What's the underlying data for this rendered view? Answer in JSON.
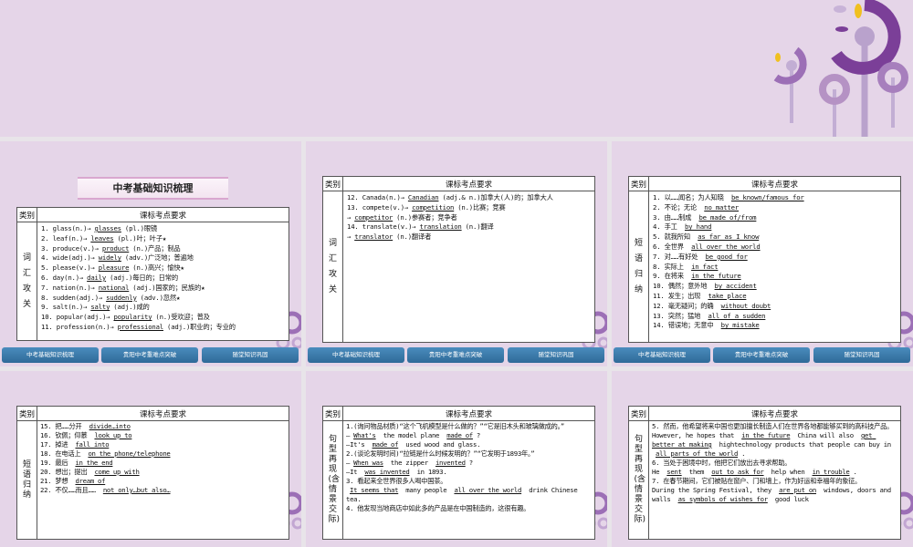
{
  "nav": [
    "中考基础知识梳理",
    "贵阳中考重难点突破",
    "随堂知识巩固"
  ],
  "header": [
    "类别",
    "课标考点要求"
  ],
  "colors": {
    "slide_bg": "#e5d5e8",
    "nav_button": "#3a78a8",
    "flower_dark": "#7b3f98",
    "flower_light": "#b9a2cc",
    "flower_yellow": "#f0c020"
  },
  "slides": [
    {
      "banner": "中考基础知识梳理",
      "category": "词汇攻关",
      "lines": [
        [
          {
            "text": "1. glass(n.)→"
          },
          {
            "text": "glasses",
            "blank": true
          },
          {
            "text": "(pl.)眼镜"
          }
        ],
        [
          {
            "text": "2. leaf(n.)→"
          },
          {
            "text": "leaves",
            "blank": true
          },
          {
            "text": "(pl.)叶；叶子★"
          }
        ],
        [
          {
            "text": "3. produce(v.)→"
          },
          {
            "text": "product",
            "blank": true
          },
          {
            "text": "(n.)产品；制品"
          }
        ],
        [
          {
            "text": "4. wide(adj.)→"
          },
          {
            "text": "widely",
            "blank": true
          },
          {
            "text": "(adv.)广泛地；普遍地"
          }
        ],
        [
          {
            "text": "5. please(v.)→"
          },
          {
            "text": "pleasure",
            "blank": true
          },
          {
            "text": "(n.)高兴；愉快★"
          }
        ],
        [
          {
            "text": "6. day(n.)→"
          },
          {
            "text": "daily",
            "blank": true
          },
          {
            "text": "(adj.)每日的；日常的"
          }
        ],
        [
          {
            "text": "7. nation(n.)→"
          },
          {
            "text": "national",
            "blank": true
          },
          {
            "text": "(adj.)国家的；民族的★"
          }
        ],
        [
          {
            "text": "8. sudden(adj.)→"
          },
          {
            "text": "suddenly",
            "blank": true
          },
          {
            "text": "(adv.)忽然★"
          }
        ],
        [
          {
            "text": "9. salt(n.)→"
          },
          {
            "text": "salty",
            "blank": true
          },
          {
            "text": "(adj.)咸的"
          }
        ],
        [
          {
            "text": "10. popular(adj.)→"
          },
          {
            "text": "popularity",
            "blank": true
          },
          {
            "text": "(n.)受欢迎；普及"
          }
        ],
        [
          {
            "text": "11. profession(n.)→"
          },
          {
            "text": "professional",
            "blank": true
          },
          {
            "text": "(adj.)职业的；专业的"
          }
        ]
      ]
    },
    {
      "category": "词汇攻关",
      "lines": [
        [
          {
            "text": "12. Canada(n.)→"
          },
          {
            "text": "Canadian",
            "blank": true
          },
          {
            "text": "(adj.& n.)加拿大(人)的；加拿大人"
          }
        ],
        [
          {
            "text": "13. compete(v.)→"
          },
          {
            "text": "competition",
            "blank": true
          },
          {
            "text": "(n.)比赛；竞赛"
          }
        ],
        [
          {
            "text": "→"
          },
          {
            "text": "competitor",
            "blank": true
          },
          {
            "text": "(n.)参赛者；竞争者"
          }
        ],
        [
          {
            "text": "14. translate(v.)→"
          },
          {
            "text": "translation",
            "blank": true
          },
          {
            "text": "(n.)翻译"
          }
        ],
        [
          {
            "text": "→"
          },
          {
            "text": "translator",
            "blank": true
          },
          {
            "text": "(n.)翻译者"
          }
        ]
      ]
    },
    {
      "category": "短语归纳",
      "lines": [
        [
          {
            "text": "1. 以……闻名；为人知晓 "
          },
          {
            "text": "be known/famous for",
            "blank": true
          }
        ],
        [
          {
            "text": "2. 不论；无论 "
          },
          {
            "text": "no matter",
            "blank": true
          }
        ],
        [
          {
            "text": "3. 由……制成 "
          },
          {
            "text": "be made of/from",
            "blank": true
          }
        ],
        [
          {
            "text": "4. 手工 "
          },
          {
            "text": "by hand",
            "blank": true
          }
        ],
        [
          {
            "text": "5. 就我所知 "
          },
          {
            "text": "as far as I know",
            "blank": true
          }
        ],
        [
          {
            "text": "6. 全世界 "
          },
          {
            "text": "all over the world",
            "blank": true
          }
        ],
        [
          {
            "text": "7. 对……有好处 "
          },
          {
            "text": "be good for",
            "blank": true
          }
        ],
        [
          {
            "text": "8. 实际上 "
          },
          {
            "text": "in fact",
            "blank": true
          }
        ],
        [
          {
            "text": "9. 在将来 "
          },
          {
            "text": "in the future",
            "blank": true
          }
        ],
        [
          {
            "text": "10. 偶然；意外地 "
          },
          {
            "text": "by accident",
            "blank": true
          }
        ],
        [
          {
            "text": "11. 发生；出现 "
          },
          {
            "text": "take place",
            "blank": true
          }
        ],
        [
          {
            "text": "12. 毫无疑问；的确 "
          },
          {
            "text": "without doubt",
            "blank": true
          }
        ],
        [
          {
            "text": "13. 突然；猛地 "
          },
          {
            "text": "all of a sudden",
            "blank": true
          }
        ],
        [
          {
            "text": "14. 错误地；无意中 "
          },
          {
            "text": "by mistake",
            "blank": true
          }
        ]
      ]
    },
    {
      "category": "短语归纳",
      "lines": [
        [
          {
            "text": "15. 把……分开 "
          },
          {
            "text": "divide…into",
            "blank": true
          }
        ],
        [
          {
            "text": "16. 钦佩；仰慕 "
          },
          {
            "text": "look up to",
            "blank": true
          }
        ],
        [
          {
            "text": "17. 掉进 "
          },
          {
            "text": "fall into",
            "blank": true
          }
        ],
        [
          {
            "text": "18. 在电话上 "
          },
          {
            "text": "on the phone/telephone",
            "blank": true
          }
        ],
        [
          {
            "text": "19. 最后 "
          },
          {
            "text": "in the end",
            "blank": true
          }
        ],
        [
          {
            "text": "20. 想出；提出 "
          },
          {
            "text": "come up with",
            "blank": true
          }
        ],
        [
          {
            "text": "21. 梦想 "
          },
          {
            "text": "dream of",
            "blank": true
          }
        ],
        [
          {
            "text": "22. 不仅……而且…… "
          },
          {
            "text": "not only…but also…",
            "blank": true
          }
        ]
      ]
    },
    {
      "category": "句型再现(含情景交际)",
      "lines": [
        [
          {
            "text": "1.(询问物品材质)“这个飞机模型是什么做的？”“它是旧木头和玻璃做成的。”"
          }
        ],
        [
          {
            "text": "—"
          },
          {
            "text": "What's",
            "blank": true
          },
          {
            "text": " the model plane "
          },
          {
            "text": "made of",
            "blank": true
          },
          {
            "text": "?"
          }
        ],
        [
          {
            "text": "—It's "
          },
          {
            "text": "made of",
            "blank": true
          },
          {
            "text": " used wood and glass."
          }
        ],
        [
          {
            "text": "2.(谈论发明时间)“拉链是什么时候发明的？”“它发明于1893年。”"
          }
        ],
        [
          {
            "text": "—"
          },
          {
            "text": "When was",
            "blank": true
          },
          {
            "text": " the zipper "
          },
          {
            "text": "invented",
            "blank": true
          },
          {
            "text": "?"
          }
        ],
        [
          {
            "text": "—It "
          },
          {
            "text": "was invented",
            "blank": true
          },
          {
            "text": " in 1893."
          }
        ],
        [
          {
            "text": "3. 看起来全世界很多人喝中国茶。"
          }
        ],
        [
          {
            "text": "It seems that",
            "blank": true
          },
          {
            "text": " many people "
          },
          {
            "text": "all over the world",
            "blank": true
          },
          {
            "text": " drink Chinese tea."
          }
        ],
        [
          {
            "text": "4. 他发现当地商店中如此多的产品是在中国制造的，这很有趣。"
          }
        ]
      ]
    },
    {
      "category": "句型再现(含情景交际)",
      "lines": [
        [
          {
            "text": "5. 然而，他希望将来中国也更加擅长制造人们在世界各地都能够买到的高科技产品。"
          }
        ],
        [
          {
            "text": "However, he hopes that "
          },
          {
            "text": "in the future",
            "blank": true
          },
          {
            "text": " China will also "
          },
          {
            "text": "get better at making",
            "blank": true
          },
          {
            "text": " hightechnology products that people can buy in "
          },
          {
            "text": "all parts of the world",
            "blank": true
          },
          {
            "text": "."
          }
        ],
        [
          {
            "text": "6. 当处于困境中时，他把它们放出去寻求帮助。"
          }
        ],
        [
          {
            "text": "He "
          },
          {
            "text": "sent",
            "blank": true
          },
          {
            "text": " them "
          },
          {
            "text": "out to ask for",
            "blank": true
          },
          {
            "text": " help when "
          },
          {
            "text": "in trouble",
            "blank": true
          },
          {
            "text": "."
          }
        ],
        [
          {
            "text": "7. 在春节期间，它们被贴在窗户、门和墙上，作为好运和幸福年的象征。"
          }
        ],
        [
          {
            "text": "During the Spring Festival, they "
          },
          {
            "text": "are put on",
            "blank": true
          },
          {
            "text": " windows, doors and walls "
          },
          {
            "text": "as symbols of wishes for",
            "blank": true
          },
          {
            "text": " good luck"
          }
        ]
      ]
    }
  ]
}
